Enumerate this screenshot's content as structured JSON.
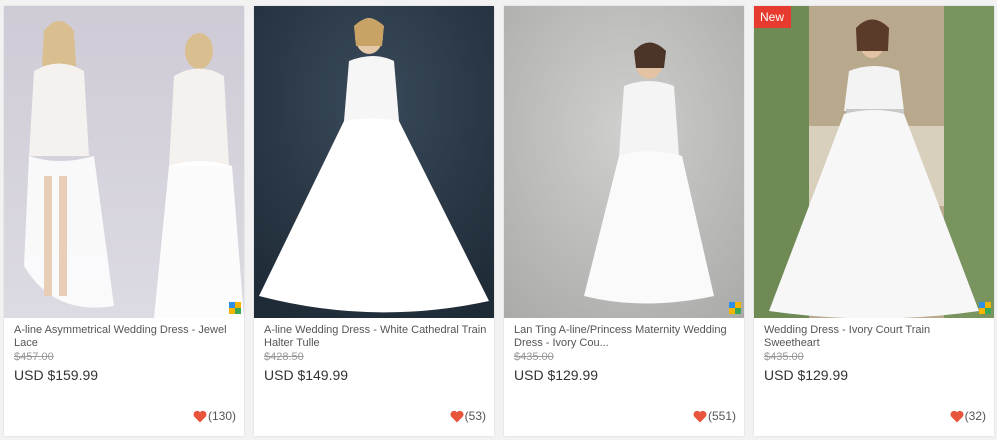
{
  "products": [
    {
      "title": "A-line Asymmetrical Wedding Dress - Jewel Lace",
      "original_price": "$457.00",
      "price": "USD $159.99",
      "favorites": "(130)",
      "badge": ""
    },
    {
      "title": "A-line Wedding Dress - White Cathedral Train Halter Tulle",
      "original_price": "$428.50",
      "price": "USD $149.99",
      "favorites": "(53)",
      "badge": ""
    },
    {
      "title": "Lan Ting A-line/Princess Maternity Wedding Dress - Ivory Cou...",
      "original_price": "$435.00",
      "price": "USD $129.99",
      "favorites": "(551)",
      "badge": ""
    },
    {
      "title": "Wedding Dress - Ivory Court Train Sweetheart",
      "original_price": "$435.00",
      "price": "USD $129.99",
      "favorites": "(32)",
      "badge": "New"
    }
  ],
  "colors": {
    "heart": "#e8553d",
    "badge": "#e63b2e",
    "text": "#555555",
    "strike": "#999999"
  },
  "icons": {
    "favorite": "heart-icon",
    "brand": "brand-mark-icon"
  }
}
